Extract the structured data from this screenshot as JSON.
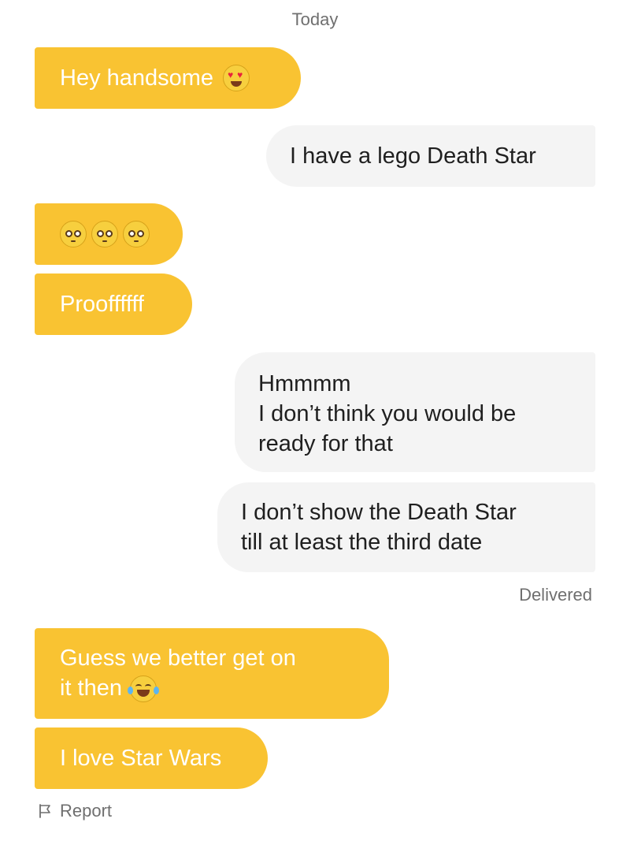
{
  "chat": {
    "date_header": "Today",
    "messages": [
      {
        "direction": "incoming",
        "text": "Hey handsome",
        "emoji": "heart-eyes-icon"
      },
      {
        "direction": "outgoing",
        "text": "I have a lego Death Star"
      },
      {
        "direction": "incoming",
        "emoji": [
          "pleading-face-icon",
          "pleading-face-icon",
          "pleading-face-icon"
        ]
      },
      {
        "direction": "incoming",
        "text": "Prooffffff"
      },
      {
        "direction": "outgoing",
        "lines": [
          "Hmmmm",
          "I don’t think you would be",
          "ready for that"
        ]
      },
      {
        "direction": "outgoing",
        "lines": [
          "I don’t show the Death Star",
          "till at least the third date"
        ]
      },
      {
        "direction": "incoming",
        "lines": [
          "Guess we better get on",
          "it then"
        ],
        "emoji": "tears-of-joy-icon"
      },
      {
        "direction": "incoming",
        "text": "I love Star Wars"
      }
    ],
    "status": "Delivered",
    "report_label": "Report"
  },
  "colors": {
    "incoming_bubble": "#f9c332",
    "outgoing_bubble": "#f4f4f4",
    "meta_text": "#6f6f6f"
  }
}
